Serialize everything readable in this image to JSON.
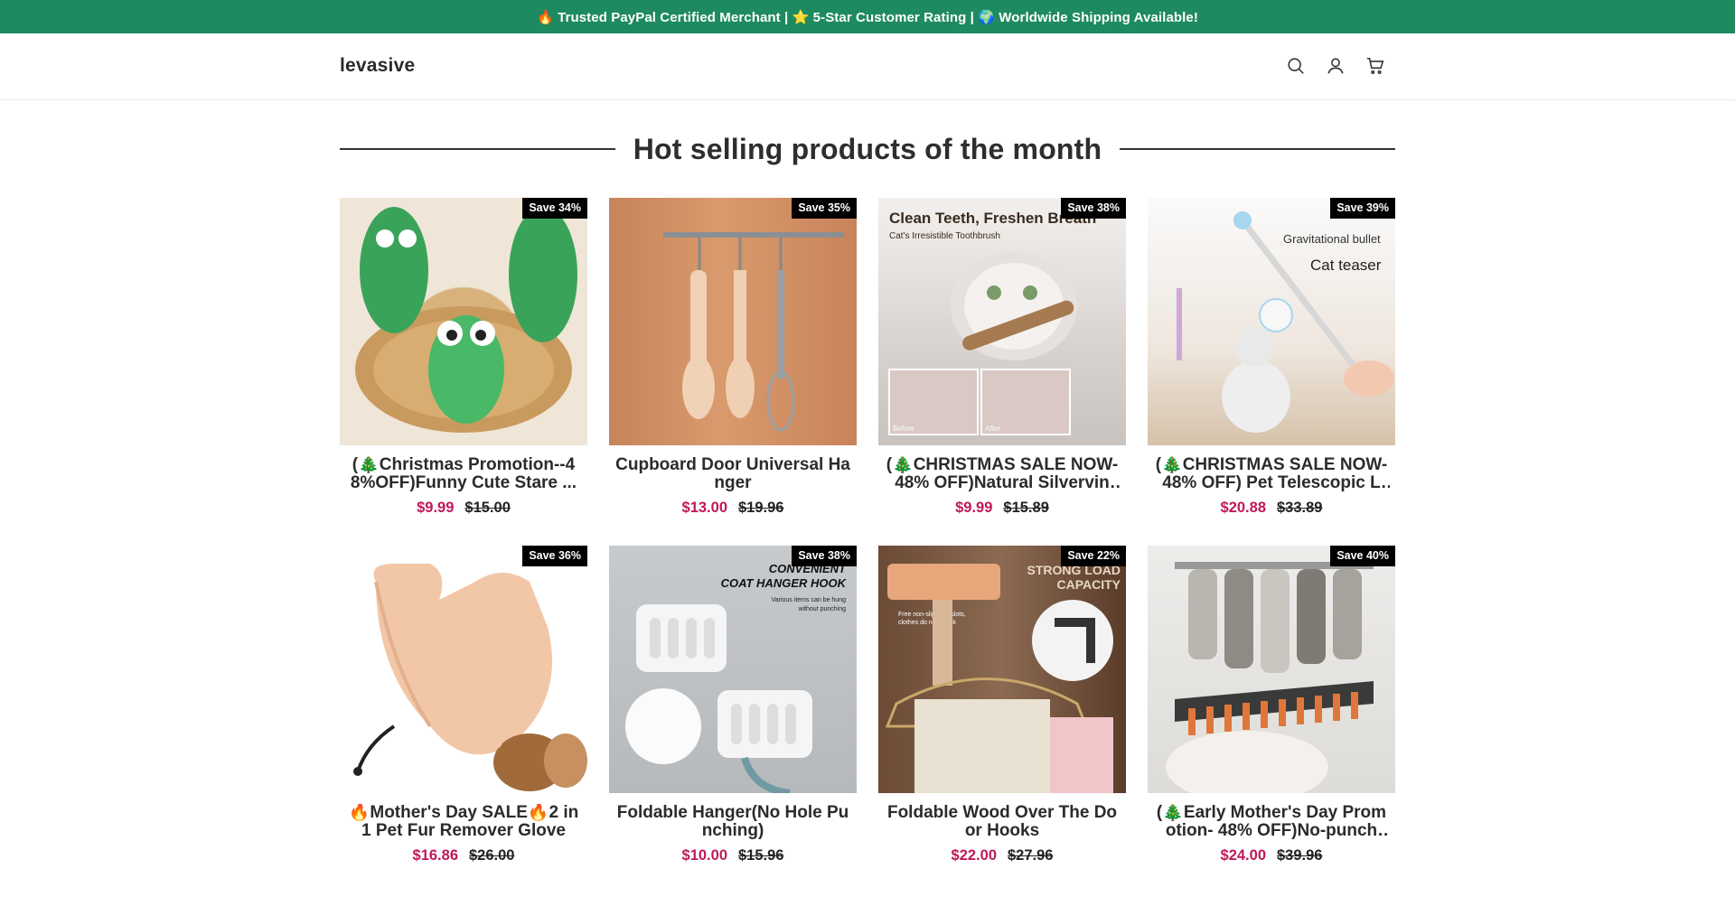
{
  "announcement": "🔥 Trusted PayPal Certified Merchant | ⭐ 5-Star Customer Rating | 🌍 Worldwide Shipping Available!",
  "header": {
    "logo": "levasive",
    "icons": [
      "search-icon",
      "account-icon",
      "cart-icon"
    ]
  },
  "section": {
    "title": "Hot selling products of the month"
  },
  "products": [
    {
      "title": "(🎄Christmas Promotion--48%OFF)Funny Cute Stare ...",
      "badge": "Save 34%",
      "price": "$9.99",
      "compare": "$15.00",
      "art": "green-squeeze-toys",
      "image_text": []
    },
    {
      "title": "Cupboard Door Universal Hanger",
      "badge": "Save 35%",
      "price": "$13.00",
      "compare": "$19.96",
      "art": "door-hanger-utensils",
      "image_text": []
    },
    {
      "title": "(🎄CHRISTMAS SALE NOW-48% OFF)Natural Silvervine...",
      "badge": "Save 38%",
      "price": "$9.99",
      "compare": "$15.89",
      "art": "cat-toothbrush",
      "image_text": [
        "Clean Teeth, Freshen Breath",
        "Cat's Irresistible Toothbrush",
        "Before",
        "After"
      ]
    },
    {
      "title": "(🎄CHRISTMAS SALE NOW-48% OFF) Pet Telescopic La...",
      "badge": "Save 39%",
      "price": "$20.88",
      "compare": "$33.89",
      "art": "cat-teaser",
      "image_text": [
        "Gravitational bullet",
        "Cat teaser"
      ]
    },
    {
      "title": "🔥Mother's Day SALE🔥2 in 1 Pet Fur Remover Glove",
      "badge": "Save 36%",
      "price": "$16.86",
      "compare": "$26.00",
      "art": "pet-glove",
      "image_text": []
    },
    {
      "title": "Foldable Hanger(No Hole Punching)",
      "badge": "Save 38%",
      "price": "$10.00",
      "compare": "$15.96",
      "art": "coat-hanger-hook",
      "image_text": [
        "CONVENIENT",
        "COAT HANGER HOOK",
        "Various items can be hung",
        "without punching"
      ]
    },
    {
      "title": "Foldable Wood Over The Door Hooks",
      "badge": "Save 22%",
      "price": "$22.00",
      "compare": "$27.96",
      "art": "over-door-hook",
      "image_text": [
        "STRONG LOAD",
        "CAPACITY",
        "Free non-slip card slots,",
        "clothes do not shock"
      ]
    },
    {
      "title": "(🎄Early Mother's Day Promotion- 48% OFF)No-punch s...",
      "badge": "Save 40%",
      "price": "$24.00",
      "compare": "$39.96",
      "art": "sock-clip-hanger",
      "image_text": []
    }
  ],
  "colors": {
    "announcement_bg": "#1e8a5f",
    "sale_price": "#c0185a",
    "badge_bg": "#000000"
  }
}
